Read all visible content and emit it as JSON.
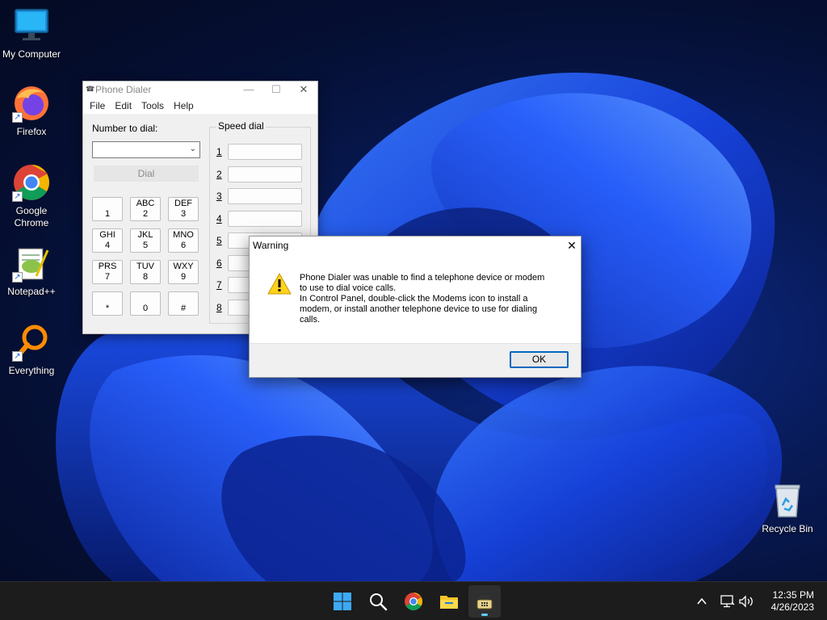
{
  "desktop_icons": [
    {
      "name": "my-computer",
      "label": "My Computer",
      "icon": "monitor-icon"
    },
    {
      "name": "firefox",
      "label": "Firefox",
      "icon": "firefox-icon"
    },
    {
      "name": "google-chrome",
      "label": "Google Chrome",
      "icon": "chrome-icon"
    },
    {
      "name": "notepad-plus-plus",
      "label": "Notepad++",
      "icon": "notepad-icon"
    },
    {
      "name": "everything",
      "label": "Everything",
      "icon": "magnifier-icon"
    },
    {
      "name": "recycle-bin",
      "label": "Recycle Bin",
      "icon": "recycle-bin-icon"
    }
  ],
  "dialer": {
    "title": "Phone Dialer",
    "menu": [
      "File",
      "Edit",
      "Tools",
      "Help"
    ],
    "number_label": "Number to dial:",
    "number_value": "",
    "dial_label": "Dial",
    "keypad": [
      {
        "letters": "",
        "digit": "1"
      },
      {
        "letters": "ABC",
        "digit": "2"
      },
      {
        "letters": "DEF",
        "digit": "3"
      },
      {
        "letters": "GHI",
        "digit": "4"
      },
      {
        "letters": "JKL",
        "digit": "5"
      },
      {
        "letters": "MNO",
        "digit": "6"
      },
      {
        "letters": "PRS",
        "digit": "7"
      },
      {
        "letters": "TUV",
        "digit": "8"
      },
      {
        "letters": "WXY",
        "digit": "9"
      },
      {
        "letters": "",
        "digit": "*"
      },
      {
        "letters": "",
        "digit": "0"
      },
      {
        "letters": "",
        "digit": "#"
      }
    ],
    "speed_dial_label": "Speed dial",
    "speed_dial_numbers": [
      "1",
      "2",
      "3",
      "4",
      "5",
      "6",
      "7",
      "8"
    ]
  },
  "warning": {
    "title": "Warning",
    "line1": "Phone Dialer was unable to find a telephone device or modem",
    "line2": "to use to dial voice calls.",
    "line3": "In Control Panel, double-click the Modems icon to install a",
    "line4": "modem, or install another telephone device to use for dialing",
    "line5": "calls.",
    "ok_label": "OK",
    "icon": "warning-icon"
  },
  "taskbar": {
    "buttons": [
      "start-icon",
      "search-icon",
      "chrome-icon",
      "file-explorer-icon",
      "phone-dialer-icon"
    ],
    "active": "phone-dialer-icon",
    "time": "12:35 PM",
    "date": "4/26/2023"
  }
}
